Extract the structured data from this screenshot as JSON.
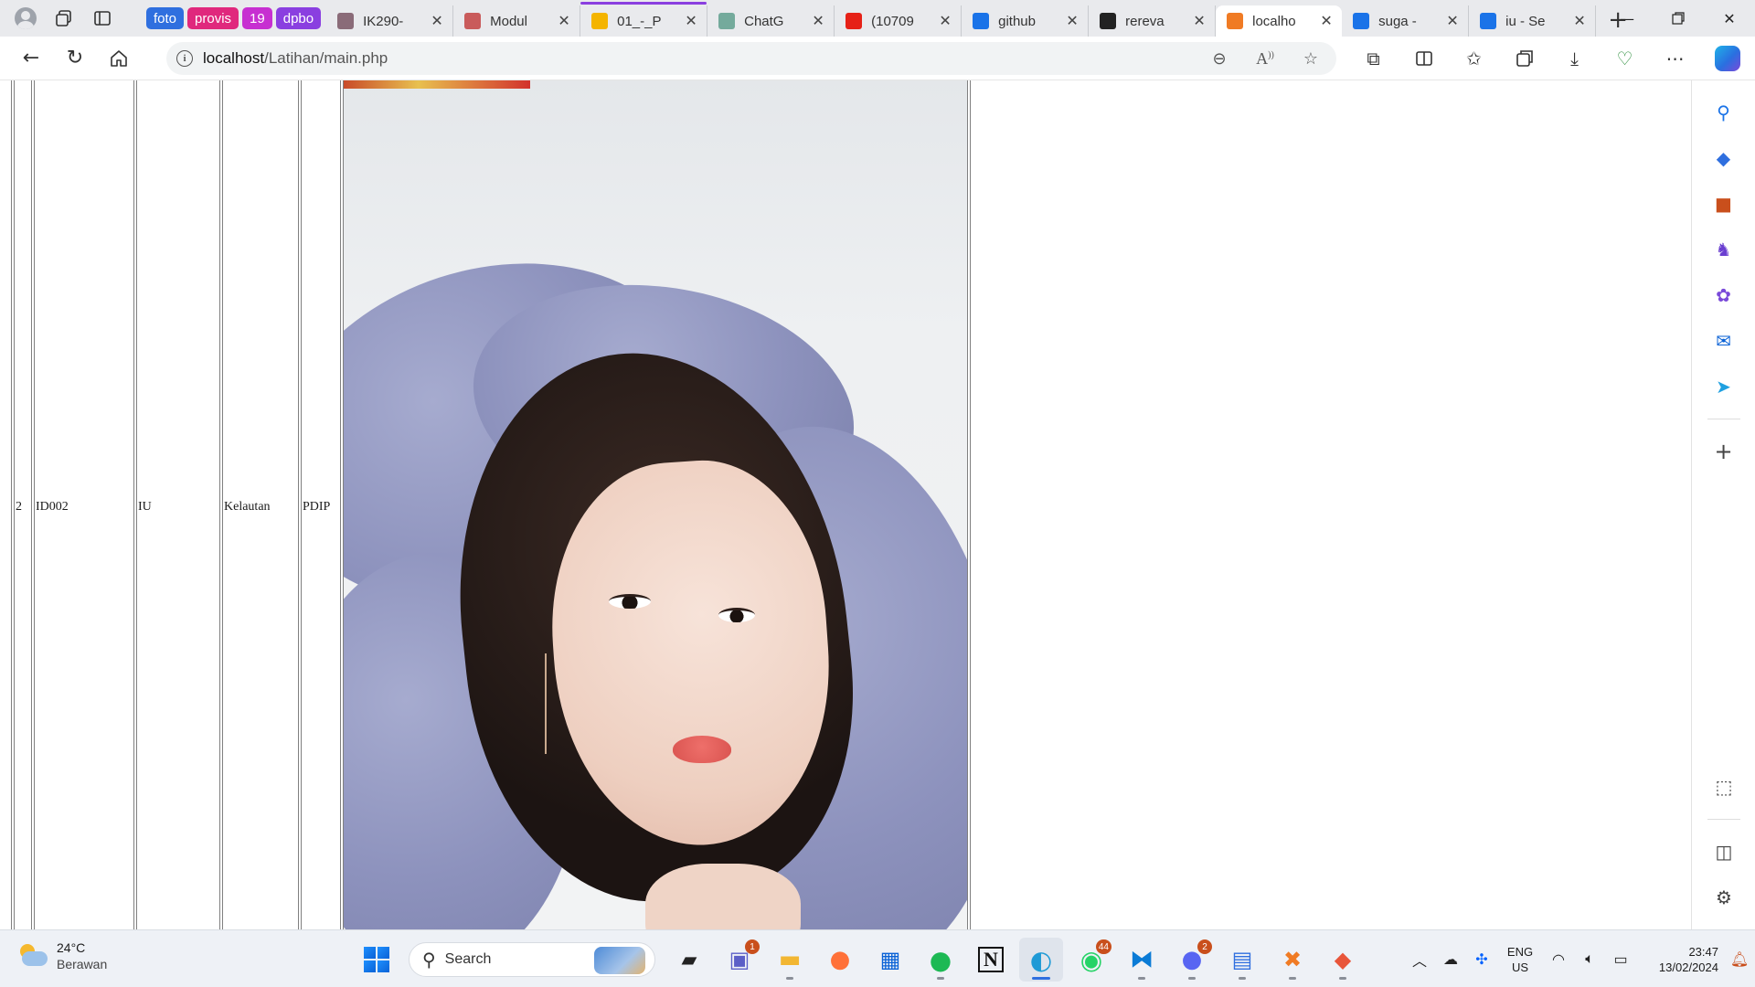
{
  "browser": {
    "tab_groups": [
      {
        "label": "foto",
        "color": "#2f6fdf"
      },
      {
        "label": "provis",
        "color": "#e0287d"
      },
      {
        "label": "19",
        "color": "#c72fd1"
      },
      {
        "label": "dpbo",
        "color": "#8a3fe0"
      }
    ],
    "tabs": [
      {
        "label": "IK290-",
        "icon": "bookmark-stack-icon",
        "icon_color": "#8a6b78"
      },
      {
        "label": "Modul",
        "icon": "pdf-document-icon",
        "icon_color": "#c95b5b"
      },
      {
        "label": "01_-_P",
        "icon": "google-drive-icon",
        "icon_color": "#f4b400",
        "group_color": "#8a3fe0"
      },
      {
        "label": "ChatG",
        "icon": "chatgpt-icon",
        "icon_color": "#74aa9c"
      },
      {
        "label": "(10709",
        "icon": "youtube-icon",
        "icon_color": "#e62117"
      },
      {
        "label": "github",
        "icon": "search-icon",
        "icon_color": "#1a73e8"
      },
      {
        "label": "rereva",
        "icon": "github-icon",
        "icon_color": "#222222"
      },
      {
        "label": "localho",
        "icon": "xampp-icon",
        "icon_color": "#f07b24",
        "active": true
      },
      {
        "label": "suga -",
        "icon": "search-icon",
        "icon_color": "#1a73e8"
      },
      {
        "label": "iu - Se",
        "icon": "search-icon",
        "icon_color": "#1a73e8"
      }
    ],
    "address": {
      "host": "localhost",
      "path": "/Latihan/main.php"
    }
  },
  "page": {
    "row": {
      "no": "2",
      "id": "ID002",
      "nama": "IU",
      "alamat": "Kelautan",
      "partai": "PDIP"
    }
  },
  "taskbar": {
    "weather": {
      "temp": "24°C",
      "desc": "Berawan"
    },
    "search_label": "Search",
    "badges": {
      "teams": "1",
      "whatsapp": "44",
      "discord": "2"
    },
    "language": {
      "top": "ENG",
      "bottom": "US"
    },
    "time": "23:47",
    "date": "13/02/2024"
  }
}
